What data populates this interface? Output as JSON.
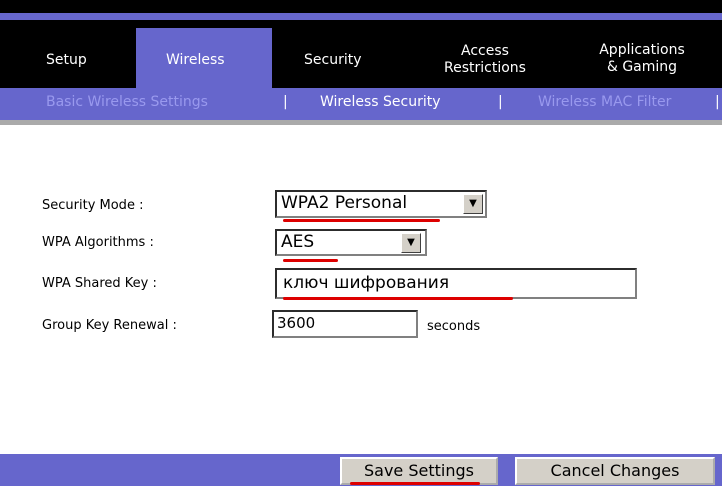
{
  "nav": {
    "tabs": [
      {
        "label": "Setup"
      },
      {
        "label": "Wireless"
      },
      {
        "label": "Security"
      },
      {
        "label_line1": "Access",
        "label_line2": "Restrictions"
      },
      {
        "label_line1": "Applications",
        "label_line2": "& Gaming"
      }
    ],
    "active_tab": "Wireless"
  },
  "subnav": {
    "items": [
      "Basic Wireless Settings",
      "Wireless Security",
      "Wireless MAC Filter"
    ],
    "separator": "|",
    "active_item": "Wireless Security"
  },
  "form": {
    "security_mode": {
      "label": "Security Mode :",
      "value": "WPA2 Personal"
    },
    "wpa_algorithms": {
      "label": "WPA Algorithms :",
      "value": "AES"
    },
    "shared_key": {
      "label": "WPA Shared Key :",
      "value": "ключ шифрования"
    },
    "group_key_renewal": {
      "label": "Group Key Renewal :",
      "value": "3600",
      "unit": "seconds"
    }
  },
  "buttons": {
    "save": "Save Settings",
    "cancel": "Cancel Changes"
  },
  "colors": {
    "nav_bg": "#000000",
    "accent": "#6666cc",
    "subnav_inactive": "#9999ee",
    "annotation": "#dd0000"
  }
}
